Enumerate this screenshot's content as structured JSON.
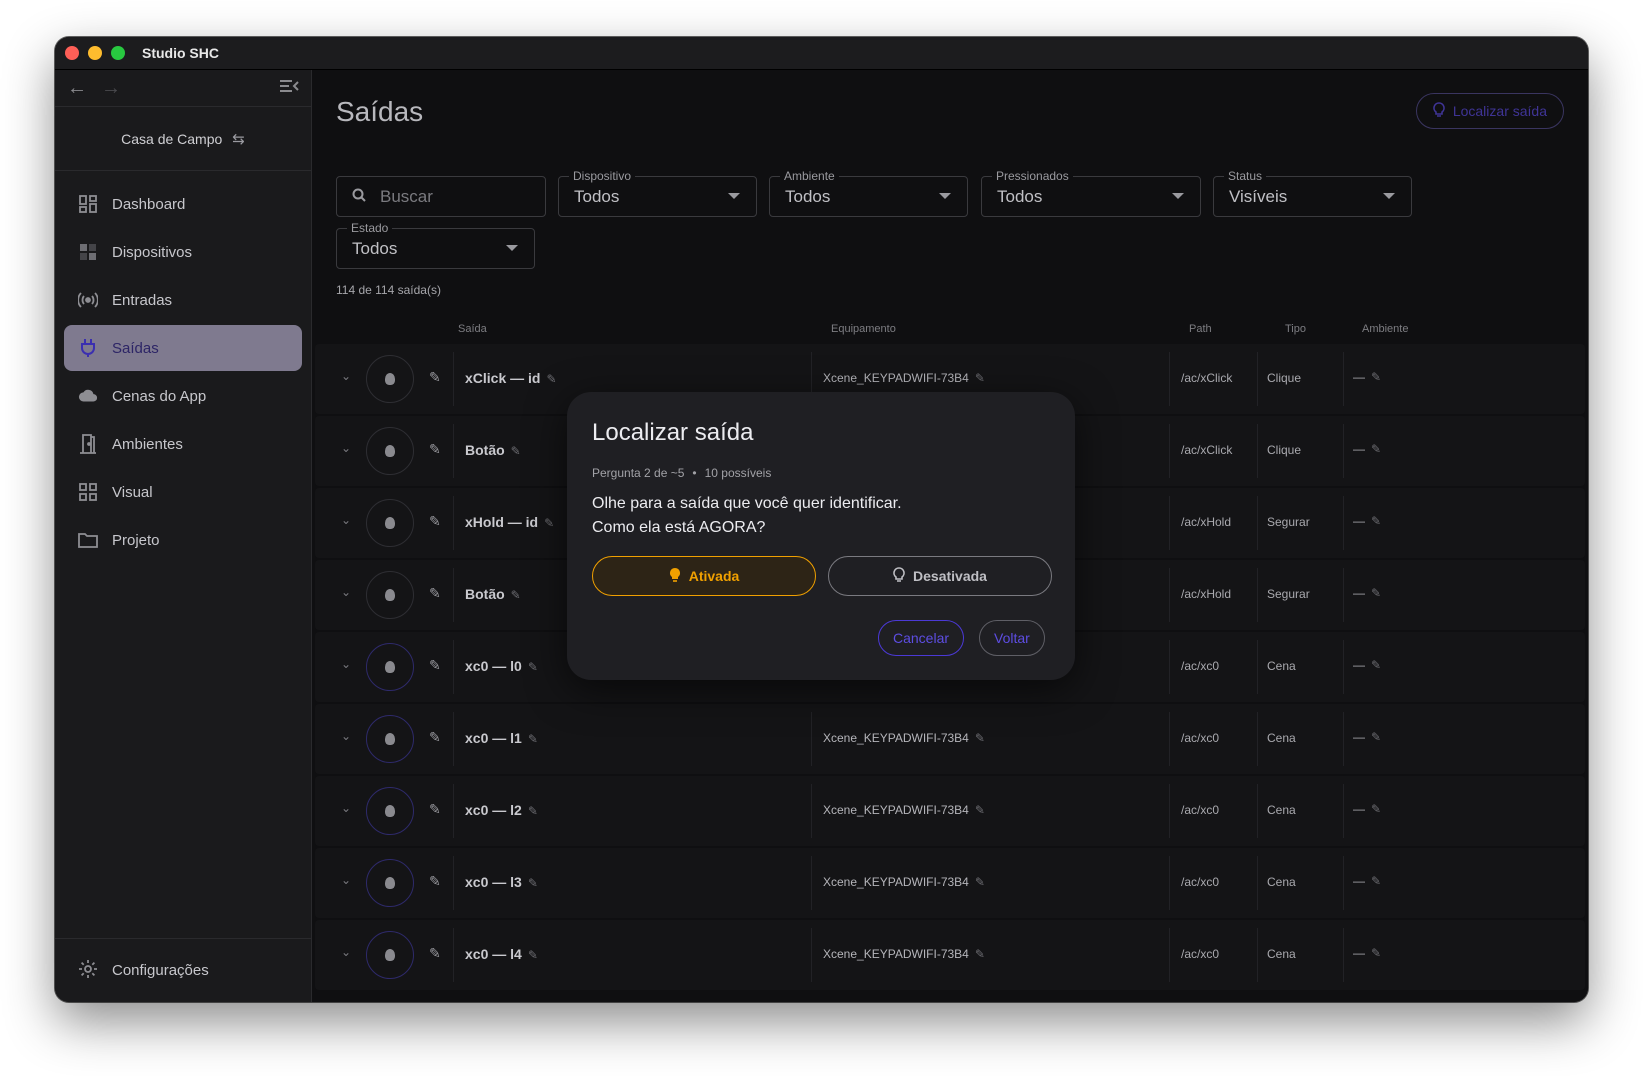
{
  "window": {
    "title": "Studio SHC"
  },
  "sidebar": {
    "project_name": "Casa de Campo",
    "items": [
      {
        "label": "Dashboard",
        "icon": "dashboard-icon"
      },
      {
        "label": "Dispositivos",
        "icon": "devices-icon"
      },
      {
        "label": "Entradas",
        "icon": "broadcast-icon"
      },
      {
        "label": "Saídas",
        "icon": "plug-icon",
        "active": true
      },
      {
        "label": "Cenas do App",
        "icon": "cloud-icon"
      },
      {
        "label": "Ambientes",
        "icon": "door-icon"
      },
      {
        "label": "Visual",
        "icon": "grid-icon"
      },
      {
        "label": "Projeto",
        "icon": "folder-icon"
      }
    ],
    "settings_label": "Configurações"
  },
  "main": {
    "title": "Saídas",
    "locate_button": "Localizar saída",
    "search_placeholder": "Buscar",
    "filters": {
      "dispositivo": {
        "label": "Dispositivo",
        "value": "Todos"
      },
      "ambiente": {
        "label": "Ambiente",
        "value": "Todos"
      },
      "pressionados": {
        "label": "Pressionados",
        "value": "Todos"
      },
      "status": {
        "label": "Status",
        "value": "Visíveis"
      },
      "estado": {
        "label": "Estado",
        "value": "Todos"
      }
    },
    "count_text": "114 de 114 saída(s)",
    "columns": {
      "saida": "Saída",
      "equipamento": "Equipamento",
      "path": "Path",
      "tipo": "Tipo",
      "ambiente": "Ambiente"
    },
    "rows": [
      {
        "name": "xClick — id",
        "equip": "Xcene_KEYPADWIFI-73B4",
        "path": "/ac/xClick",
        "tipo": "Clique",
        "amb": "—"
      },
      {
        "name": "Botão",
        "equip": "",
        "path": "/ac/xClick",
        "tipo": "Clique",
        "amb": "—"
      },
      {
        "name": "xHold — id",
        "equip": "",
        "path": "/ac/xHold",
        "tipo": "Segurar",
        "amb": "—"
      },
      {
        "name": "Botão",
        "equip": "",
        "path": "/ac/xHold",
        "tipo": "Segurar",
        "amb": "—"
      },
      {
        "name": "xc0 — l0",
        "equip": "",
        "path": "/ac/xc0",
        "tipo": "Cena",
        "amb": "—"
      },
      {
        "name": "xc0 — l1",
        "equip": "Xcene_KEYPADWIFI-73B4",
        "path": "/ac/xc0",
        "tipo": "Cena",
        "amb": "—"
      },
      {
        "name": "xc0 — l2",
        "equip": "Xcene_KEYPADWIFI-73B4",
        "path": "/ac/xc0",
        "tipo": "Cena",
        "amb": "—"
      },
      {
        "name": "xc0 — l3",
        "equip": "Xcene_KEYPADWIFI-73B4",
        "path": "/ac/xc0",
        "tipo": "Cena",
        "amb": "—"
      },
      {
        "name": "xc0 — l4",
        "equip": "Xcene_KEYPADWIFI-73B4",
        "path": "/ac/xc0",
        "tipo": "Cena",
        "amb": "—"
      }
    ]
  },
  "modal": {
    "title": "Localizar saída",
    "progress": "Pergunta 2 de ~5",
    "possible": "10 possíveis",
    "question_line1": "Olhe para a saída que você quer identificar.",
    "question_line2": "Como ela está AGORA?",
    "option_on": "Ativada",
    "option_off": "Desativada",
    "cancel": "Cancelar",
    "back": "Voltar"
  },
  "colors": {
    "accent": "#4b39d6",
    "active_option": "#f0a000",
    "active_nav_bg": "#7f7a8f"
  }
}
